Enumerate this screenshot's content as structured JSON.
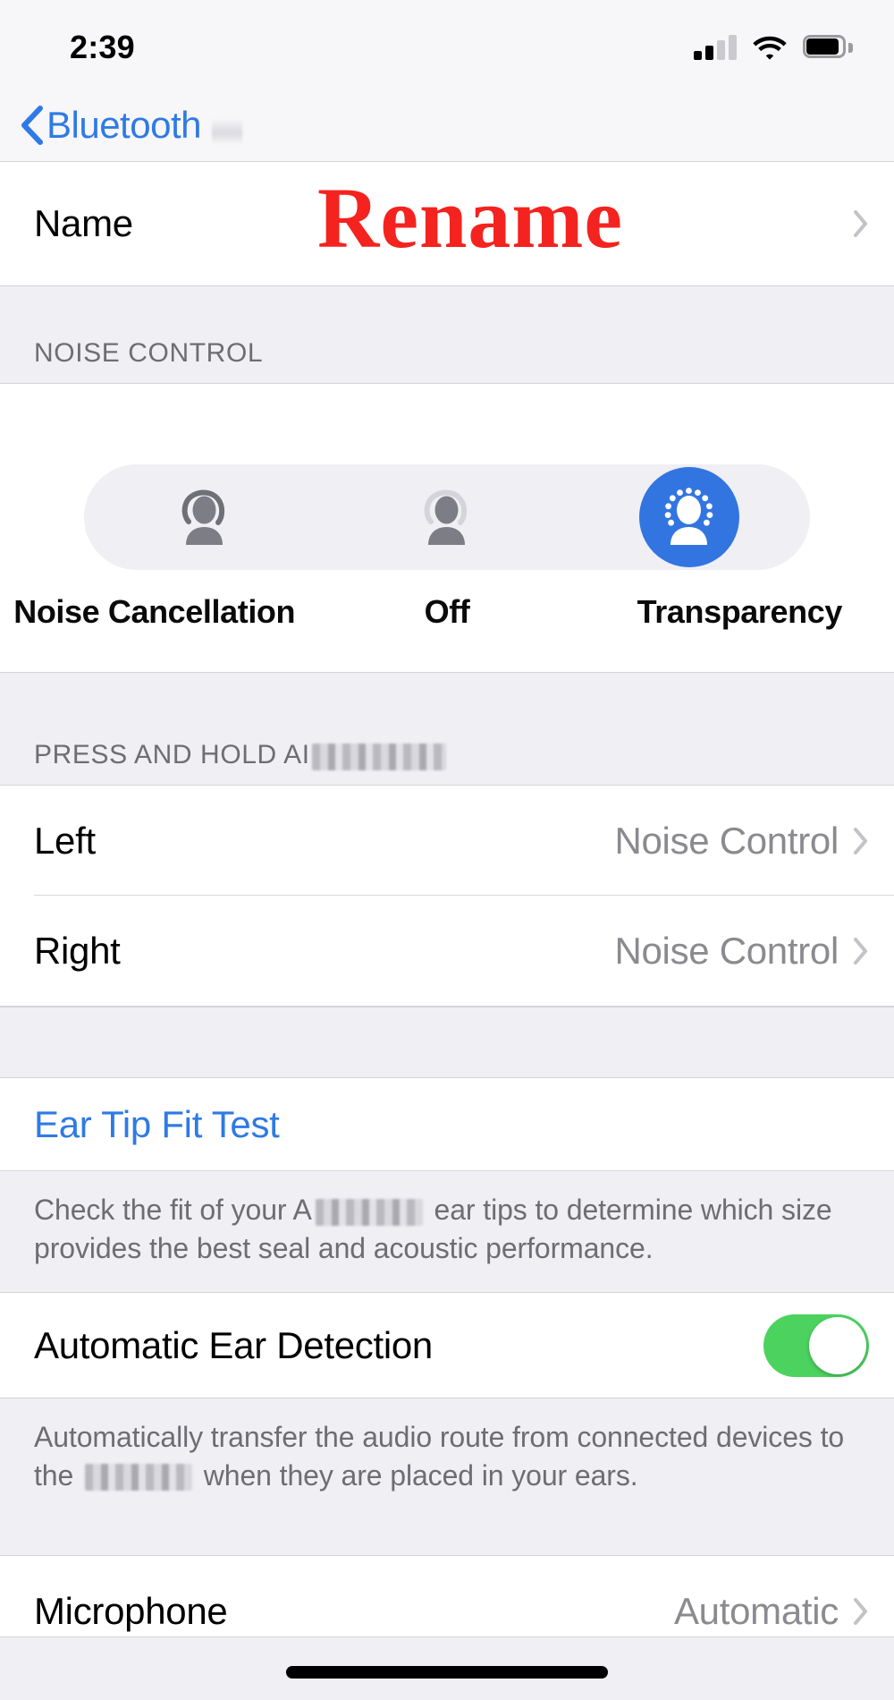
{
  "status_bar": {
    "time": "2:39",
    "signal_icon": "cellular-signal-icon",
    "signal_bars_filled": 2,
    "signal_bars_total": 4,
    "wifi_icon": "wifi-icon",
    "battery_icon": "battery-icon",
    "battery_level_percent": 85
  },
  "nav": {
    "back_icon": "chevron-left-icon",
    "back_label": "Bluetooth"
  },
  "annotation": {
    "rename_label": "Rename",
    "rename_color": "#f4231f"
  },
  "name_row": {
    "label": "Name",
    "chevron_icon": "chevron-right-icon"
  },
  "noise_control": {
    "header": "NOISE CONTROL",
    "selected": "Transparency",
    "options": [
      {
        "label": "Noise Cancellation",
        "icon": "person-noise-cancellation-icon",
        "selected": false
      },
      {
        "label": "Off",
        "icon": "person-off-icon",
        "selected": false
      },
      {
        "label": "Transparency",
        "icon": "person-transparency-icon",
        "selected": true
      }
    ],
    "selected_color": "#3375e0"
  },
  "press_and_hold": {
    "header_prefix": "PRESS AND HOLD AI",
    "header_redacted": true,
    "rows": [
      {
        "label": "Left",
        "value": "Noise Control",
        "chevron_icon": "chevron-right-icon"
      },
      {
        "label": "Right",
        "value": "Noise Control",
        "chevron_icon": "chevron-right-icon"
      }
    ]
  },
  "ear_tip_fit_test": {
    "label": "Ear Tip Fit Test",
    "description_before": "Check the fit of your A",
    "description_after": " ear tips to determine which size provides the best seal and acoustic performance."
  },
  "automatic_ear_detection": {
    "label": "Automatic Ear Detection",
    "toggle_state": "on",
    "toggle_color": "#4cd35f",
    "description_before": "Automatically transfer the audio route from connected devices to the ",
    "description_after": " when they are placed in your ears."
  },
  "microphone_row": {
    "label": "Microphone",
    "value": "Automatic",
    "chevron_icon": "chevron-right-icon"
  },
  "home_indicator": {
    "icon": "home-indicator-bar"
  }
}
